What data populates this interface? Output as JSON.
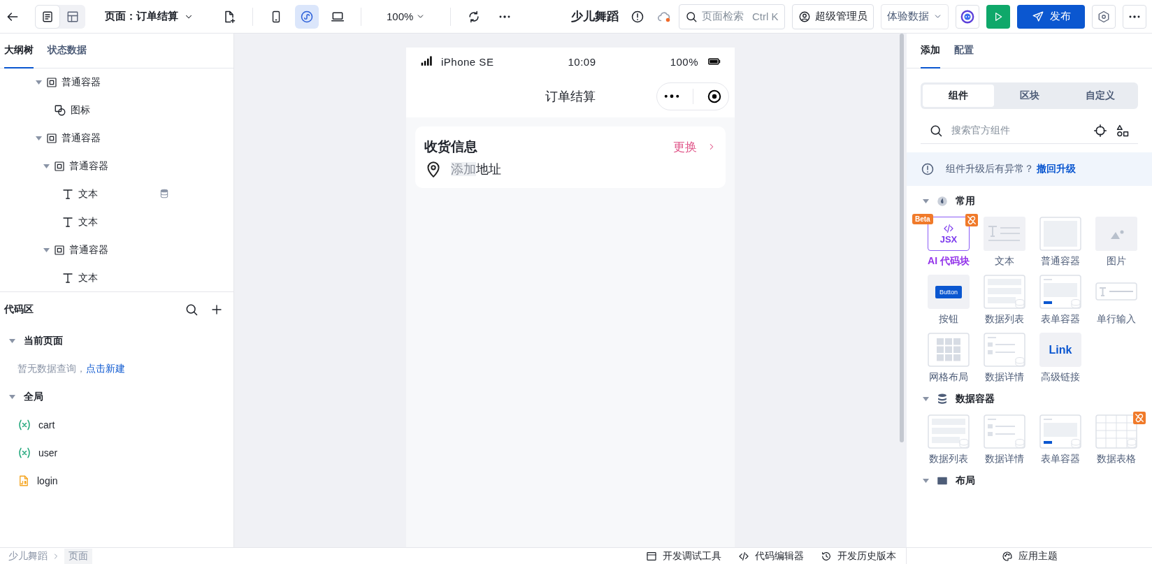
{
  "topbar": {
    "view_modes": [
      {
        "kind": "page",
        "selected": true
      },
      {
        "kind": "layout",
        "selected": false
      }
    ],
    "page_selector": "页面：订单结算",
    "devices": [
      {
        "kind": "phone",
        "selected": false
      },
      {
        "kind": "miniprogram",
        "selected": true
      },
      {
        "kind": "desktop",
        "selected": false
      }
    ],
    "zoom": "100%",
    "app_title": "少儿舞蹈",
    "sync_pending": true,
    "search": {
      "placeholder": "页面检索",
      "shortcut": "Ctrl K"
    },
    "user": "超级管理员",
    "data_source": "体验数据",
    "publish": "发布"
  },
  "left_panel": {
    "tabs": [
      {
        "label": "大纲树",
        "selected": true
      },
      {
        "label": "状态数据",
        "selected": false
      }
    ],
    "tree": [
      {
        "label": "普通容器",
        "kind": "container",
        "expanded": true,
        "children": [
          {
            "label": "图标",
            "kind": "icon"
          }
        ]
      },
      {
        "label": "普通容器",
        "kind": "container",
        "expanded": true,
        "children": [
          {
            "label": "普通容器",
            "kind": "container",
            "expanded": true,
            "children": [
              {
                "label": "文本",
                "kind": "text",
                "bound": true
              },
              {
                "label": "文本",
                "kind": "text",
                "bound": false
              }
            ]
          },
          {
            "label": "普通容器",
            "kind": "container",
            "expanded": true,
            "children": [
              {
                "label": "文本",
                "kind": "text",
                "bound": false
              }
            ]
          }
        ]
      }
    ],
    "code_area": {
      "title": "代码区",
      "groups": [
        {
          "label": "当前页面",
          "expanded": true,
          "empty_text": "暂无数据查询，",
          "empty_link": "点击新建"
        },
        {
          "label": "全局",
          "expanded": true,
          "items": [
            {
              "name": "cart",
              "kind": "variable"
            },
            {
              "name": "user",
              "kind": "variable"
            },
            {
              "name": "login",
              "kind": "script"
            }
          ]
        }
      ]
    }
  },
  "phone": {
    "device": "iPhone SE",
    "time": "10:09",
    "battery": "100%",
    "nav_title": "订单结算",
    "card": {
      "title": "收货信息",
      "action": "更换",
      "address_highlighted": "添加",
      "address_rest": "地址"
    }
  },
  "right_panel": {
    "tabs": [
      {
        "label": "添加",
        "selected": true
      },
      {
        "label": "配置",
        "selected": false
      }
    ],
    "segments": [
      {
        "label": "组件",
        "selected": true
      },
      {
        "label": "区块",
        "selected": false
      },
      {
        "label": "自定义",
        "selected": false
      }
    ],
    "search_placeholder": "搜索官方组件",
    "notice": {
      "text": "组件升级后有异常？",
      "link": "撤回升级"
    },
    "sections": [
      {
        "title": "常用",
        "kind": "common",
        "expanded": true,
        "items": [
          {
            "label": "AI 代码块",
            "kind": "jsx",
            "thumb_text": "JSX",
            "badge": "Beta",
            "upgrade": true
          },
          {
            "label": "文本",
            "kind": "text",
            "upgrade": false
          },
          {
            "label": "普通容器",
            "kind": "container",
            "upgrade": false
          },
          {
            "label": "图片",
            "kind": "image",
            "upgrade": false
          },
          {
            "label": "按钮",
            "kind": "button",
            "thumb_text": "Button",
            "upgrade": false
          },
          {
            "label": "数据列表",
            "kind": "list",
            "upgrade": false
          },
          {
            "label": "表单容器",
            "kind": "form",
            "upgrade": false
          },
          {
            "label": "单行输入",
            "kind": "input",
            "upgrade": false
          },
          {
            "label": "网格布局",
            "kind": "grid",
            "upgrade": false
          },
          {
            "label": "数据详情",
            "kind": "detail",
            "upgrade": false
          },
          {
            "label": "高级链接",
            "kind": "link",
            "thumb_text": "Link",
            "upgrade": false
          }
        ]
      },
      {
        "title": "数据容器",
        "kind": "data",
        "expanded": true,
        "items": [
          {
            "label": "数据列表",
            "kind": "list",
            "upgrade": false
          },
          {
            "label": "数据详情",
            "kind": "detail",
            "upgrade": false
          },
          {
            "label": "表单容器",
            "kind": "form",
            "upgrade": false
          },
          {
            "label": "数据表格",
            "kind": "table",
            "upgrade": true
          }
        ]
      },
      {
        "title": "布局",
        "kind": "layout",
        "expanded": true
      }
    ]
  },
  "bottom_bar": {
    "breadcrumb": [
      "少儿舞蹈",
      "页面"
    ],
    "tools": [
      {
        "label": "开发调试工具",
        "kind": "debug"
      },
      {
        "label": "代码编辑器",
        "kind": "code"
      },
      {
        "label": "开发历史版本",
        "kind": "history"
      }
    ],
    "theme": "应用主题"
  }
}
